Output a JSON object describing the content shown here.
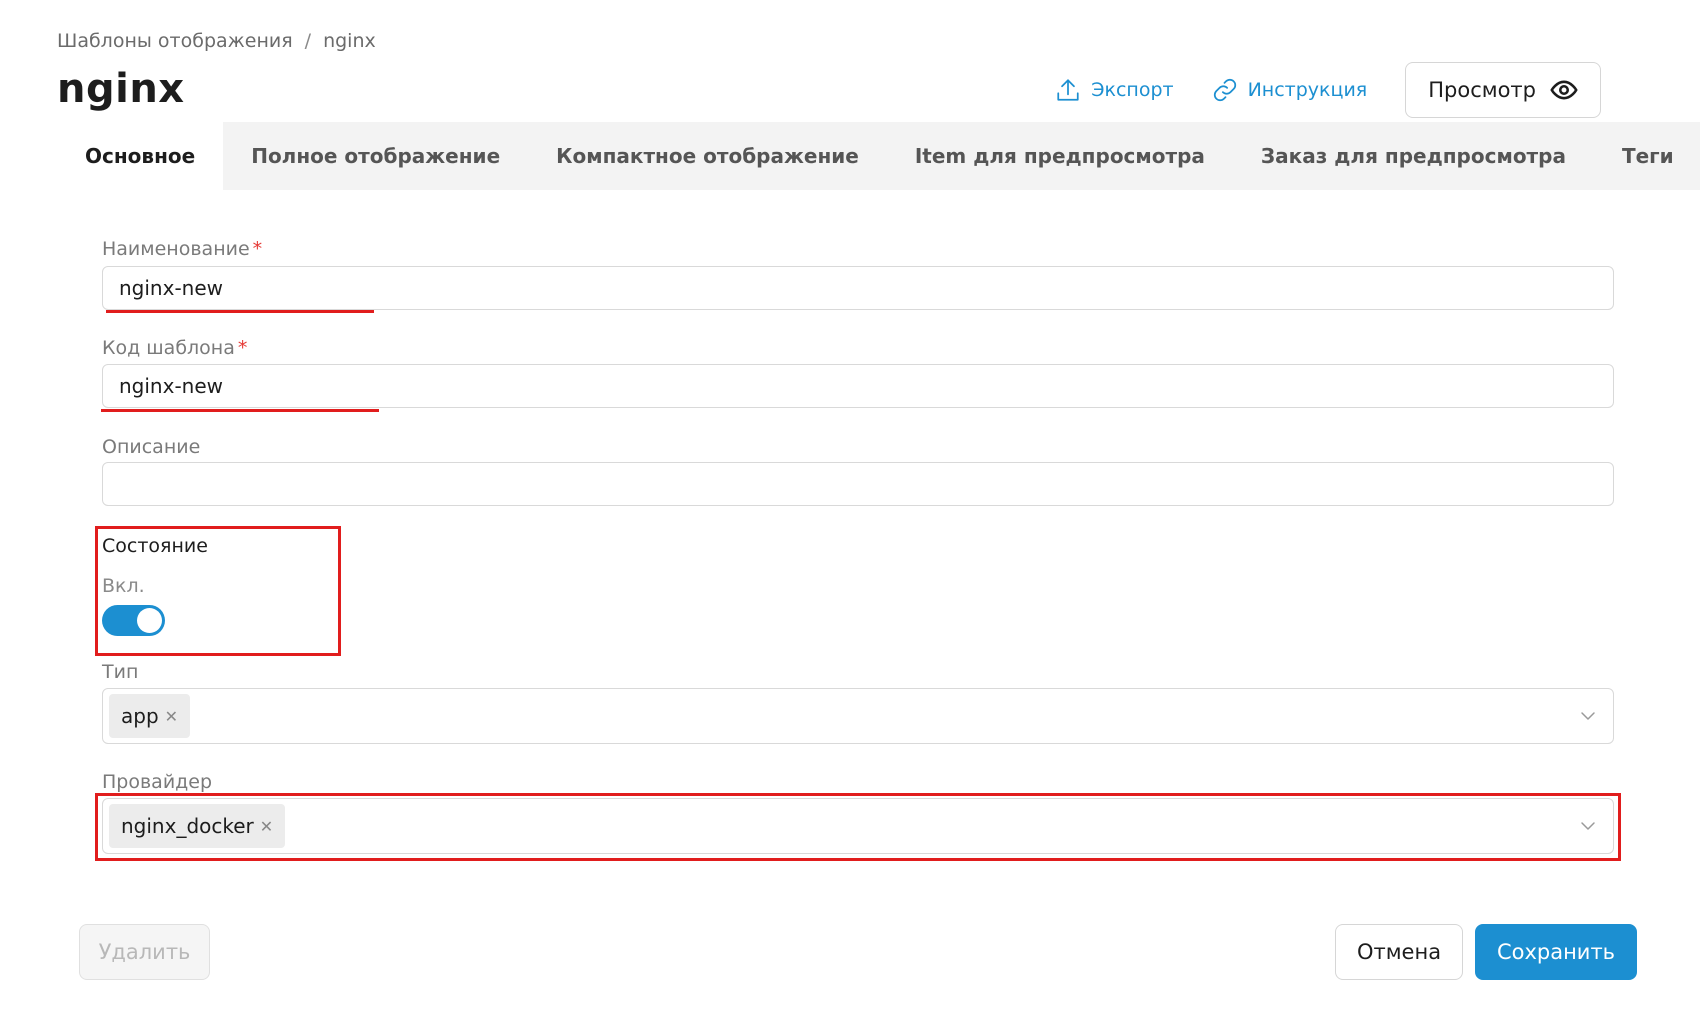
{
  "breadcrumb": {
    "parent": "Шаблоны отображения",
    "separator": "/",
    "current": "nginx"
  },
  "page": {
    "title": "nginx"
  },
  "header_actions": {
    "export_label": "Экспорт",
    "instruction_label": "Инструкция",
    "view_label": "Просмотр"
  },
  "tabs": [
    {
      "label": "Основное",
      "active": true
    },
    {
      "label": "Полное отображение",
      "active": false
    },
    {
      "label": "Компактное отображение",
      "active": false
    },
    {
      "label": "Item для предпросмотра",
      "active": false
    },
    {
      "label": "Заказ для предпросмотра",
      "active": false
    },
    {
      "label": "Теги",
      "active": false
    }
  ],
  "form": {
    "name": {
      "label": "Наименование",
      "required_mark": "*",
      "value": "nginx-new"
    },
    "code": {
      "label": "Код шаблона",
      "required_mark": "*",
      "value": "nginx-new"
    },
    "description": {
      "label": "Описание",
      "value": ""
    },
    "state": {
      "label": "Состояние",
      "toggle_label": "Вкл.",
      "enabled": true
    },
    "type": {
      "label": "Тип",
      "chips": [
        "app"
      ]
    },
    "provider": {
      "label": "Провайдер",
      "chips": [
        "nginx_docker"
      ]
    }
  },
  "footer": {
    "delete_label": "Удалить",
    "cancel_label": "Отмена",
    "save_label": "Сохранить"
  },
  "colors": {
    "accent": "#1c8fd1",
    "annotation": "#e11d1d",
    "required": "#e53935"
  },
  "icons": {
    "export": "upload-icon",
    "instruction": "link-icon",
    "view": "eye-icon",
    "select": "chevron-down-icon",
    "chip_remove": "close-icon"
  }
}
